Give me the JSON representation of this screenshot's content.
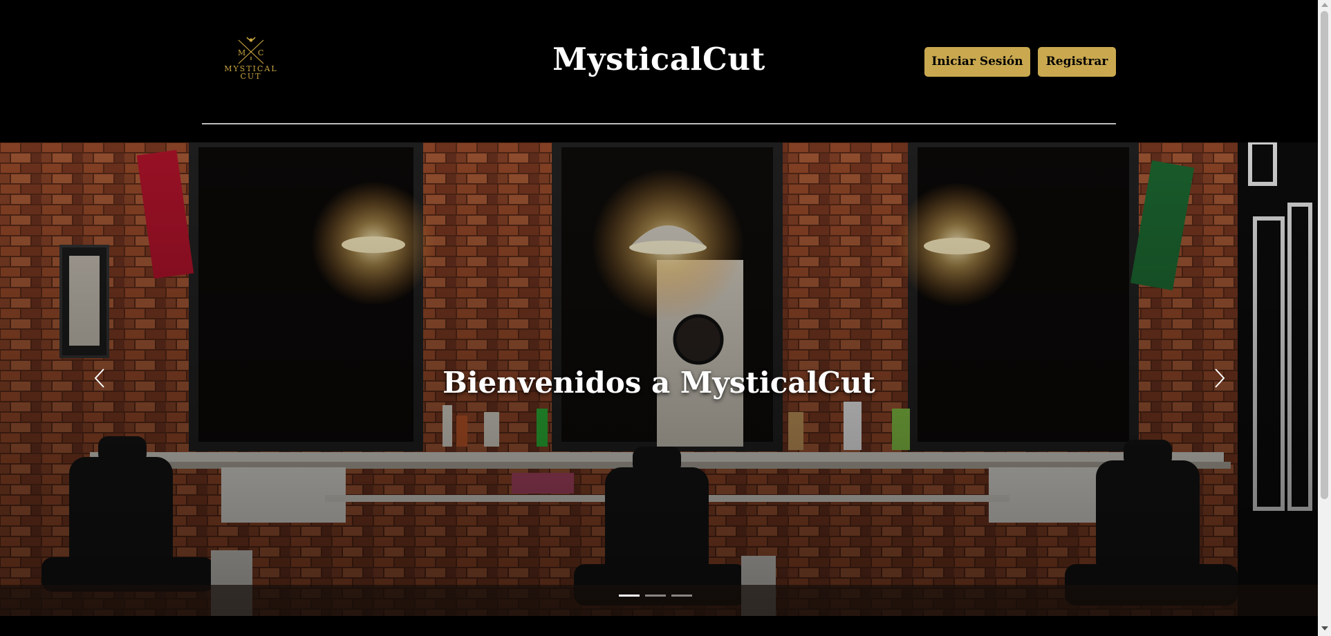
{
  "header": {
    "logo": {
      "initials_left": "M",
      "initials_right": "C",
      "line1": "MYSTICAL",
      "line2": "CUT"
    },
    "title": "MysticalCut",
    "login_label": "Iniciar Sesión",
    "register_label": "Registrar"
  },
  "hero": {
    "caption": "Bienvenidos a MysticalCut",
    "prev_icon": "chevron-left-icon",
    "next_icon": "chevron-right-icon",
    "slide_count": 3,
    "active_slide": 1
  },
  "colors": {
    "accent": "#c9a84f",
    "background": "#000000",
    "divider": "#bdbdbd"
  }
}
